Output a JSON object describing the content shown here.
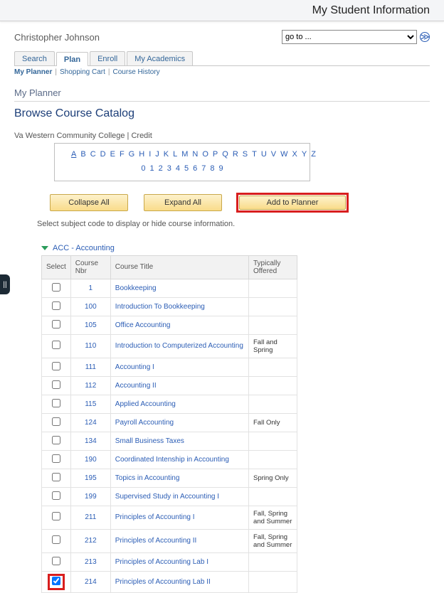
{
  "banner_title": "My Student Information",
  "student_name": "Christopher Johnson",
  "goto_placeholder": "go to ...",
  "tabs": [
    "Search",
    "Plan",
    "Enroll",
    "My Academics"
  ],
  "active_tab_index": 1,
  "subnav": [
    "My Planner",
    "Shopping Cart",
    "Course History"
  ],
  "active_subnav_index": 0,
  "page_heading": "My Planner",
  "section_title": "Browse Course Catalog",
  "college_line": "Va Western Community College | Credit",
  "alpha_links": [
    "A",
    "B",
    "C",
    "D",
    "E",
    "F",
    "G",
    "H",
    "I",
    "J",
    "K",
    "L",
    "M",
    "N",
    "O",
    "P",
    "Q",
    "R",
    "S",
    "T",
    "U",
    "V",
    "W",
    "X",
    "Y",
    "Z"
  ],
  "num_links": [
    "0",
    "1",
    "2",
    "3",
    "4",
    "5",
    "6",
    "7",
    "8",
    "9"
  ],
  "buttons": {
    "collapse": "Collapse All",
    "expand": "Expand All",
    "add": "Add to Planner"
  },
  "instruction": "Select subject code to display or hide course information.",
  "subject_header": "ACC - Accounting",
  "table_headers": [
    "Select",
    "Course Nbr",
    "Course Title",
    "Typically Offered"
  ],
  "courses": [
    {
      "nbr": "1",
      "title": "Bookkeeping",
      "off": "",
      "checked": false
    },
    {
      "nbr": "100",
      "title": "Introduction To Bookkeeping",
      "off": "",
      "checked": false
    },
    {
      "nbr": "105",
      "title": "Office Accounting",
      "off": "",
      "checked": false
    },
    {
      "nbr": "110",
      "title": "Introduction to Computerized Accounting",
      "off": "Fall and Spring",
      "checked": false
    },
    {
      "nbr": "111",
      "title": "Accounting I",
      "off": "",
      "checked": false
    },
    {
      "nbr": "112",
      "title": "Accounting II",
      "off": "",
      "checked": false
    },
    {
      "nbr": "115",
      "title": "Applied Accounting",
      "off": "",
      "checked": false
    },
    {
      "nbr": "124",
      "title": "Payroll Accounting",
      "off": "Fall Only",
      "checked": false
    },
    {
      "nbr": "134",
      "title": "Small Business Taxes",
      "off": "",
      "checked": false
    },
    {
      "nbr": "190",
      "title": "Coordinated Intenship in Accounting",
      "off": "",
      "checked": false
    },
    {
      "nbr": "195",
      "title": "Topics in Accounting",
      "off": "Spring Only",
      "checked": false
    },
    {
      "nbr": "199",
      "title": "Supervised Study in Accounting I",
      "off": "",
      "checked": false
    },
    {
      "nbr": "211",
      "title": "Principles of Accounting I",
      "off": "Fall, Spring and Summer",
      "checked": false
    },
    {
      "nbr": "212",
      "title": "Principles of Accounting II",
      "off": "Fall, Spring and Summer",
      "checked": false
    },
    {
      "nbr": "213",
      "title": "Principles of Accounting Lab I",
      "off": "",
      "checked": false
    },
    {
      "nbr": "214",
      "title": "Principles of Accounting Lab II",
      "off": "",
      "checked": true,
      "highlight": true
    }
  ]
}
